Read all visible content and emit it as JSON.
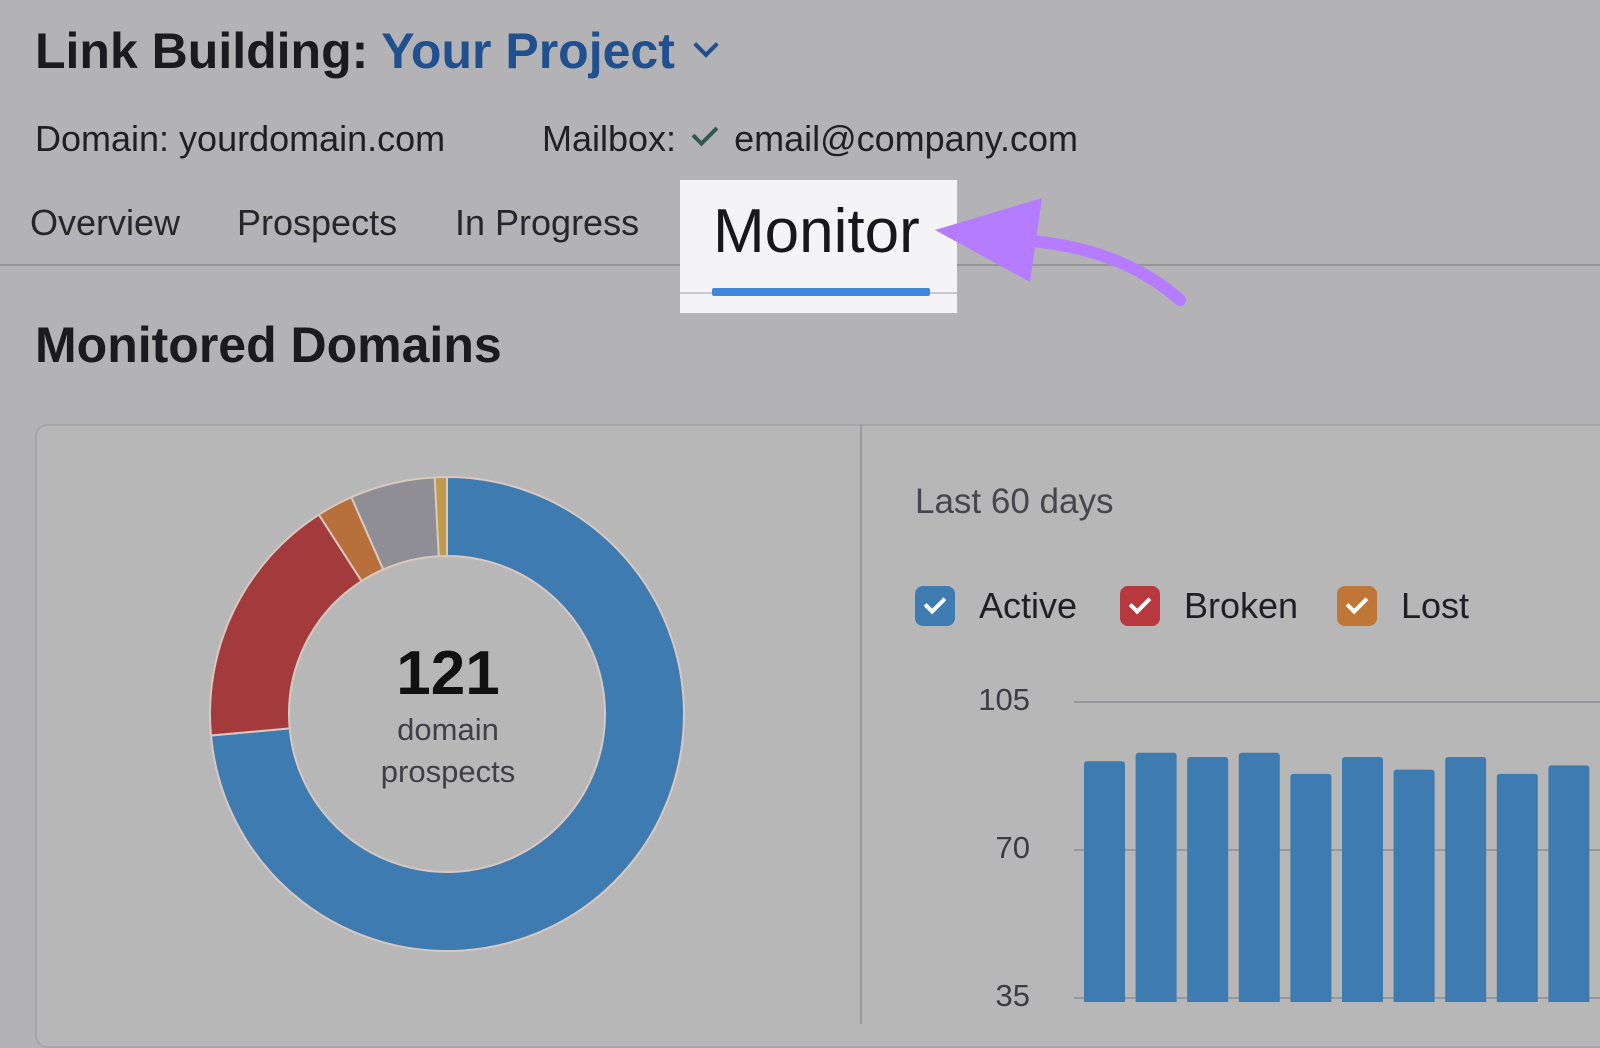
{
  "header": {
    "title_prefix": "Link Building:",
    "project": "Your Project"
  },
  "meta": {
    "domain": "Domain: yourdomain.com",
    "mailbox_label": "Mailbox:",
    "mailbox_email": "email@company.com"
  },
  "tabs": [
    {
      "label": "Overview"
    },
    {
      "label": "Prospects"
    },
    {
      "label": "In Progress"
    },
    {
      "label": "Monitor",
      "active": true
    }
  ],
  "section_title": "Monitored Domains",
  "donut": {
    "total": "121",
    "line1": "domain",
    "line2": "prospects"
  },
  "colors": {
    "blue": "#3d7bb0",
    "red": "#a33a3c",
    "orange": "#b7703a",
    "gray": "#8e8e94",
    "gold": "#c09a4a",
    "arrow": "#b57cff",
    "tab_underline": "#3f87dc"
  },
  "period": "Last 60 days",
  "legend": [
    {
      "label": "Active",
      "color": "#3d7bb0"
    },
    {
      "label": "Broken",
      "color": "#b7393d"
    },
    {
      "label": "Lost",
      "color": "#c07636"
    }
  ],
  "chart_data": [
    {
      "type": "pie",
      "donut": true,
      "slices": [
        {
          "value": 89,
          "color": "#3d7bb0"
        },
        {
          "value": 21,
          "color": "#a33a3c"
        },
        {
          "value": 3,
          "color": "#b7703a"
        },
        {
          "value": 7,
          "color": "#8e8e94"
        },
        {
          "value": 1,
          "color": "#c09a4a"
        }
      ]
    },
    {
      "type": "bar",
      "title": "Last 60 days",
      "yticks": [
        "105",
        "70",
        "35"
      ],
      "ylim": [
        0,
        105
      ],
      "grid": true,
      "series": [
        {
          "name": "Active",
          "values": [
            91,
            93,
            92,
            93,
            88,
            92,
            89,
            92,
            88,
            90
          ]
        }
      ]
    }
  ]
}
